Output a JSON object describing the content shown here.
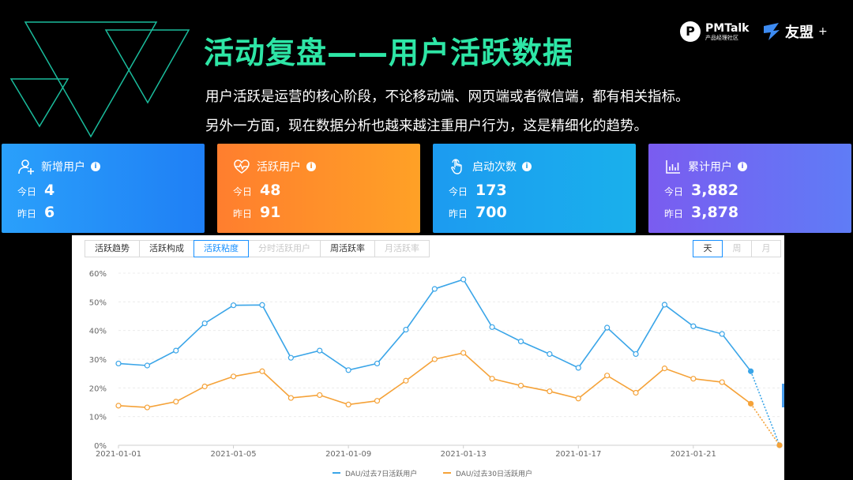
{
  "slide": {
    "title": "活动复盘——用户活跃数据",
    "desc_lines": [
      "用户活跃是运营的核心阶段，不论移动端、网页端或者微信端，都有相关指标。",
      "另外一方面，现在数据分析也越来越注重用户行为，这是精细化的趋势。"
    ]
  },
  "logos": {
    "pm_mark": "P",
    "pm_name": "PMTalk",
    "pm_sub": "产品经理社区",
    "um_name": "友盟",
    "um_plus": "+"
  },
  "colors": {
    "title": "#2ee6a6",
    "deco": "#1abc9c",
    "card_new": "#1f8efa",
    "card_active": "#ff8c1a",
    "card_launch": "#1aa6ee",
    "card_total": "#6b6cf3",
    "series_7d": "#3aa5e8",
    "series_30d": "#f5a238"
  },
  "cards": [
    {
      "name": "新增用户",
      "icon": "user-add-icon",
      "info": "i",
      "today_label": "今日",
      "today": "4",
      "yesterday_label": "昨日",
      "yesterday": "6"
    },
    {
      "name": "活跃用户",
      "icon": "heartbeat-icon",
      "info": "i",
      "today_label": "今日",
      "today": "48",
      "yesterday_label": "昨日",
      "yesterday": "91"
    },
    {
      "name": "启动次数",
      "icon": "tap-hand-icon",
      "info": "i",
      "today_label": "今日",
      "today": "173",
      "yesterday_label": "昨日",
      "yesterday": "700"
    },
    {
      "name": "累计用户",
      "icon": "bar-chart-icon",
      "info": "i",
      "today_label": "今日",
      "today": "3,882",
      "yesterday_label": "昨日",
      "yesterday": "3,878"
    }
  ],
  "tabs": [
    {
      "label": "活跃趋势",
      "state": "normal"
    },
    {
      "label": "活跃构成",
      "state": "normal"
    },
    {
      "label": "活跃粘度",
      "state": "active"
    },
    {
      "label": "分时活跃用户",
      "state": "disabled"
    },
    {
      "label": "周活跃率",
      "state": "normal"
    },
    {
      "label": "月活跃率",
      "state": "disabled"
    }
  ],
  "period_tabs": [
    {
      "label": "天",
      "state": "active"
    },
    {
      "label": "周",
      "state": "disabled"
    },
    {
      "label": "月",
      "state": "disabled"
    }
  ],
  "chart_data": {
    "type": "line",
    "x": [
      "2021-01-01",
      "2021-01-02",
      "2021-01-03",
      "2021-01-04",
      "2021-01-05",
      "2021-01-06",
      "2021-01-07",
      "2021-01-08",
      "2021-01-09",
      "2021-01-10",
      "2021-01-11",
      "2021-01-12",
      "2021-01-13",
      "2021-01-14",
      "2021-01-15",
      "2021-01-16",
      "2021-01-17",
      "2021-01-18",
      "2021-01-19",
      "2021-01-20",
      "2021-01-21",
      "2021-01-22",
      "2021-01-23",
      "2021-01-24"
    ],
    "x_tick_labels": [
      "2021-01-01",
      "2021-01-05",
      "2021-01-09",
      "2021-01-13",
      "2021-01-17",
      "2021-01-21"
    ],
    "ylim": [
      0,
      60
    ],
    "y_ticks": [
      "0%",
      "10%",
      "20%",
      "30%",
      "40%",
      "50%",
      "60%"
    ],
    "grid": true,
    "legend_position": "bottom",
    "series": [
      {
        "name": "DAU/过去7日活跃用户",
        "values": [
          28.5,
          27.8,
          33.0,
          42.5,
          48.8,
          48.9,
          30.5,
          33.0,
          26.2,
          28.5,
          40.3,
          54.5,
          57.8,
          41.2,
          36.2,
          31.8,
          27.0,
          41.0,
          31.8,
          49.0,
          41.5,
          38.8,
          25.8,
          0.0
        ]
      },
      {
        "name": "DAU/过去30日活跃用户",
        "values": [
          13.8,
          13.2,
          15.2,
          20.5,
          24.0,
          25.8,
          16.5,
          17.5,
          14.2,
          15.5,
          22.5,
          30.0,
          32.2,
          23.2,
          20.8,
          18.8,
          16.3,
          24.3,
          18.3,
          26.8,
          23.2,
          22.0,
          14.5,
          0.0
        ]
      }
    ]
  }
}
